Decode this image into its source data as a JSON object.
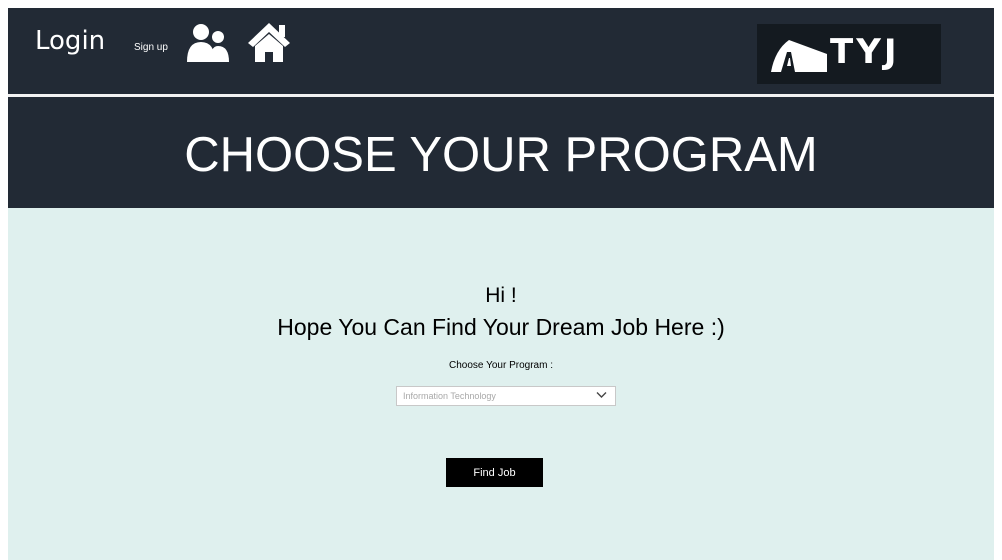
{
  "nav": {
    "login_label": "Login",
    "signup_label": "Sign up",
    "users_icon": "users-icon",
    "home_icon": "home-icon"
  },
  "logo": {
    "text": "TYJ",
    "icon": "road-icon"
  },
  "banner": {
    "title": "CHOOSE YOUR PROGRAM"
  },
  "main": {
    "greeting": "Hi !",
    "tagline": "Hope You Can Find Your Dream Job Here :)",
    "program_label": "Choose Your Program :",
    "program_select": {
      "selected": "Information Technology",
      "icon": "chevron-down-icon"
    },
    "find_button_label": "Find Job"
  },
  "colors": {
    "header_bg": "#222a35",
    "page_bg": "#dff0ee",
    "button_bg": "#000000",
    "text_light": "#ffffff"
  }
}
